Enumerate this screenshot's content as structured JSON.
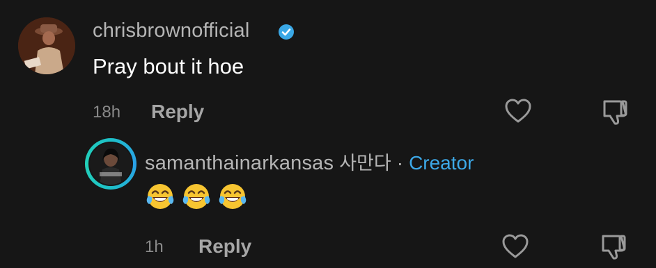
{
  "comment": {
    "username": "chrisbrownofficial",
    "verified": true,
    "text": "Pray bout it hoe",
    "time": "18h",
    "reply_label": "Reply",
    "icons": [
      "heart-outline-icon",
      "thumbs-down-icon"
    ]
  },
  "reply": {
    "username": "samanthainarkansas",
    "nickname": "사만다",
    "separator": "·",
    "badge": "Creator",
    "emojis": [
      "face-with-tears-of-joy",
      "face-with-tears-of-joy",
      "face-with-tears-of-joy"
    ],
    "time": "1h",
    "reply_label": "Reply",
    "icons": [
      "heart-outline-icon",
      "thumbs-down-icon"
    ]
  },
  "colors": {
    "background": "#161616",
    "creator_accent": "#3da9e8",
    "verified_badge": "#3aa8e6"
  }
}
